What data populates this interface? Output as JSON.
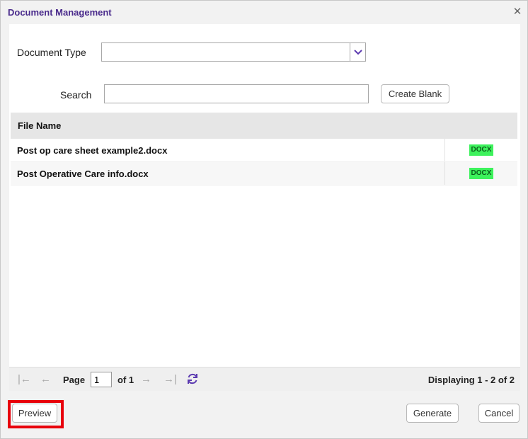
{
  "window": {
    "title": "Document Management"
  },
  "form": {
    "document_type_label": "Document Type",
    "document_type_value": "",
    "search_label": "Search",
    "search_value": "",
    "create_blank_label": "Create Blank"
  },
  "grid": {
    "column_header": "File Name",
    "rows": [
      {
        "name": "Post op care sheet example2.docx",
        "type": "DOCX"
      },
      {
        "name": "Post Operative Care info.docx",
        "type": "DOCX"
      }
    ]
  },
  "pager": {
    "page_label": "Page",
    "page_value": "1",
    "of_label": "of 1",
    "displaying": "Displaying 1 - 2 of 2"
  },
  "footer": {
    "preview_label": "Preview",
    "generate_label": "Generate",
    "cancel_label": "Cancel"
  },
  "colors": {
    "title": "#4a2b8c",
    "badge": "#3df25c",
    "highlight": "#e8000b",
    "refresh_icon": "#5b3ab0"
  },
  "icons": [
    "close-icon",
    "chevron-down-icon",
    "first-page-icon",
    "prev-page-icon",
    "next-page-icon",
    "last-page-icon",
    "refresh-icon"
  ]
}
